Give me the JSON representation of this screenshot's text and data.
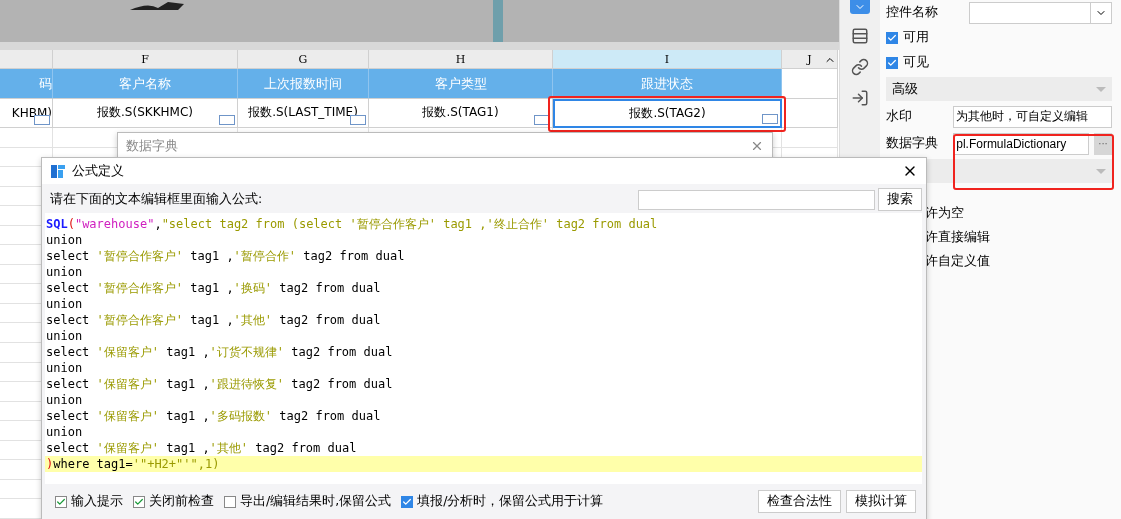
{
  "sheet": {
    "columns": [
      {
        "selected": false
      },
      {
        "letter": "F",
        "selected": false
      },
      {
        "letter": "G",
        "selected": false
      },
      {
        "letter": "H",
        "selected": false
      },
      {
        "letter": "I",
        "selected": true
      },
      {
        "letter": "J",
        "selected": false
      }
    ],
    "header_cells": [
      "码",
      "客户名称",
      "上次报数时间",
      "客户类型",
      "跟进状态"
    ],
    "data_cells": [
      {
        "text": "KHBM)",
        "selected": false
      },
      {
        "text": "报数.S(SKKHMC)",
        "selected": false
      },
      {
        "text": "报数.S(LAST_TIME)",
        "selected": false
      },
      {
        "text": "报数.S(TAG1)",
        "selected": false
      },
      {
        "text": "报数.S(TAG2)",
        "selected": true
      }
    ]
  },
  "properties": {
    "name_label": "控件名称",
    "checks": [
      {
        "label": "可用",
        "checked": true
      },
      {
        "label": "可见",
        "checked": true
      }
    ],
    "section": "高级",
    "watermark": {
      "label": "水印",
      "value": "为其他时，可自定义编辑"
    },
    "dictionary": {
      "label": "数据字典",
      "value": "pl.FormulaDictionary",
      "button": "···"
    },
    "options": [
      "许为空",
      "许直接编辑",
      "许自定义值"
    ]
  },
  "dictionary_dialog": {
    "title": "数据字典"
  },
  "formula_dialog": {
    "title": "公式定义",
    "prompt": "请在下面的文本编辑框里面输入公式:",
    "search_button": "搜索",
    "code_lines": [
      {
        "current": false,
        "segments": [
          {
            "kind": "func",
            "text": "SQL"
          },
          {
            "kind": "paren",
            "text": "("
          },
          {
            "kind": "literal",
            "text": "\"warehouse\""
          },
          {
            "kind": "text",
            "text": ","
          },
          {
            "kind": "string",
            "text": "\"select tag2 from (select '暂停合作客户' tag1 ,'终止合作' tag2 from dual"
          }
        ]
      },
      {
        "current": false,
        "segments": [
          {
            "kind": "text",
            "text": "union"
          }
        ]
      },
      {
        "current": false,
        "segments": [
          {
            "kind": "text",
            "text": "select "
          },
          {
            "kind": "string",
            "text": "'暂停合作客户'"
          },
          {
            "kind": "text",
            "text": " tag1 ,"
          },
          {
            "kind": "string",
            "text": "'暂停合作'"
          },
          {
            "kind": "text",
            "text": " tag2 from dual"
          }
        ]
      },
      {
        "current": false,
        "segments": [
          {
            "kind": "text",
            "text": "union"
          }
        ]
      },
      {
        "current": false,
        "segments": [
          {
            "kind": "text",
            "text": "select "
          },
          {
            "kind": "string",
            "text": "'暂停合作客户'"
          },
          {
            "kind": "text",
            "text": " tag1 ,"
          },
          {
            "kind": "string",
            "text": "'换码'"
          },
          {
            "kind": "text",
            "text": " tag2 from dual"
          }
        ]
      },
      {
        "current": false,
        "segments": [
          {
            "kind": "text",
            "text": "union"
          }
        ]
      },
      {
        "current": false,
        "segments": [
          {
            "kind": "text",
            "text": "select "
          },
          {
            "kind": "string",
            "text": "'暂停合作客户'"
          },
          {
            "kind": "text",
            "text": " tag1 ,"
          },
          {
            "kind": "string",
            "text": "'其他'"
          },
          {
            "kind": "text",
            "text": " tag2 from dual"
          }
        ]
      },
      {
        "current": false,
        "segments": [
          {
            "kind": "text",
            "text": "union"
          }
        ]
      },
      {
        "current": false,
        "segments": [
          {
            "kind": "text",
            "text": "select "
          },
          {
            "kind": "string",
            "text": "'保留客户'"
          },
          {
            "kind": "text",
            "text": " tag1 ,"
          },
          {
            "kind": "string",
            "text": "'订货不规律'"
          },
          {
            "kind": "text",
            "text": " tag2 from dual"
          }
        ]
      },
      {
        "current": false,
        "segments": [
          {
            "kind": "text",
            "text": "union"
          }
        ]
      },
      {
        "current": false,
        "segments": [
          {
            "kind": "text",
            "text": "select "
          },
          {
            "kind": "string",
            "text": "'保留客户'"
          },
          {
            "kind": "text",
            "text": " tag1 ,"
          },
          {
            "kind": "string",
            "text": "'跟进待恢复'"
          },
          {
            "kind": "text",
            "text": " tag2 from dual"
          }
        ]
      },
      {
        "current": false,
        "segments": [
          {
            "kind": "text",
            "text": "union"
          }
        ]
      },
      {
        "current": false,
        "segments": [
          {
            "kind": "text",
            "text": "select "
          },
          {
            "kind": "string",
            "text": "'保留客户'"
          },
          {
            "kind": "text",
            "text": " tag1 ,"
          },
          {
            "kind": "string",
            "text": "'多码报数'"
          },
          {
            "kind": "text",
            "text": " tag2 from dual"
          }
        ]
      },
      {
        "current": false,
        "segments": [
          {
            "kind": "text",
            "text": "union"
          }
        ]
      },
      {
        "current": false,
        "segments": [
          {
            "kind": "text",
            "text": "select "
          },
          {
            "kind": "string",
            "text": "'保留客户'"
          },
          {
            "kind": "text",
            "text": " tag1 ,"
          },
          {
            "kind": "string",
            "text": "'其他'"
          },
          {
            "kind": "text",
            "text": " tag2 from dual"
          }
        ]
      },
      {
        "current": true,
        "segments": [
          {
            "kind": "paren",
            "text": ")"
          },
          {
            "kind": "text",
            "text": "where tag1="
          },
          {
            "kind": "string",
            "text": "'\"+H2+\"'\",1)"
          }
        ]
      }
    ],
    "options": [
      {
        "label": "输入提示",
        "checked": true,
        "kind": "tick"
      },
      {
        "label": "关闭前检查",
        "checked": true,
        "kind": "tick"
      },
      {
        "label": "导出/编辑结果时,保留公式",
        "checked": false,
        "kind": "tick"
      },
      {
        "label": "填报/分析时，保留公式用于计算",
        "checked": true,
        "kind": "filled"
      }
    ],
    "buttons": [
      "检查合法性",
      "模拟计算"
    ]
  }
}
